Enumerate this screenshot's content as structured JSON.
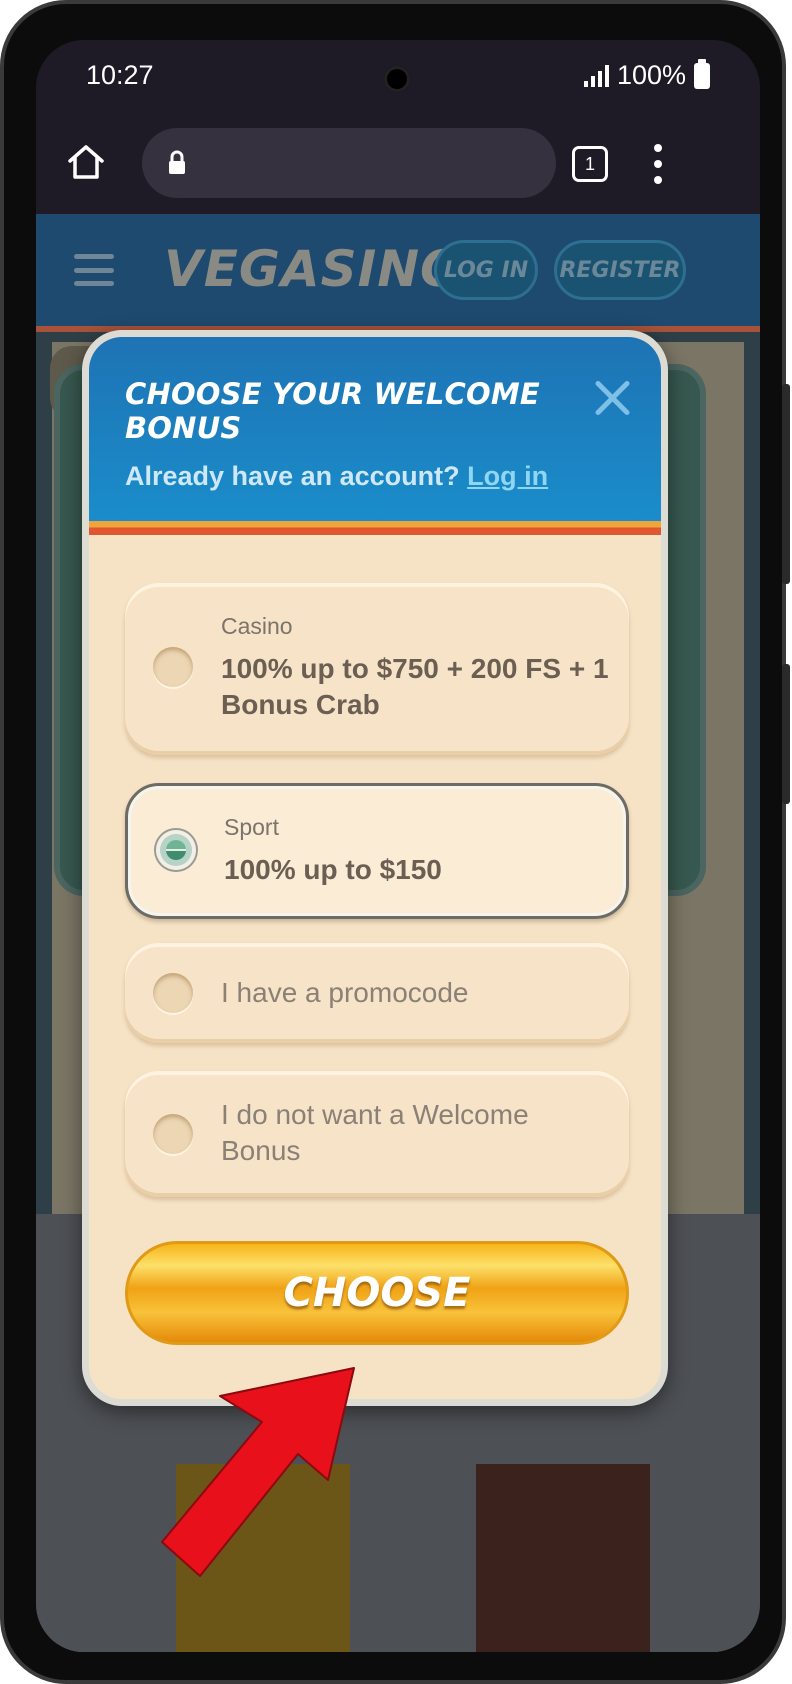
{
  "status_bar": {
    "time": "10:27",
    "battery": "100%"
  },
  "browser": {
    "tab_count": "1"
  },
  "site": {
    "logo": "VEGASINO",
    "login_button": "LOG IN",
    "register_button": "REGISTER"
  },
  "modal": {
    "title": "CHOOSE YOUR WELCOME BONUS",
    "account_prompt": "Already have an account?",
    "login_link": "Log in",
    "options": [
      {
        "category": "Casino",
        "offer": "100% up to $750 + 200 FS + 1 Bonus Crab",
        "selected": false
      },
      {
        "category": "Sport",
        "offer": "100% up to $150",
        "selected": true
      },
      {
        "label": "I have a promocode",
        "selected": false
      },
      {
        "label": "I do not want a Welcome Bonus",
        "selected": false
      }
    ],
    "choose_button": "CHOOSE"
  },
  "colors": {
    "modal_header": "#1a8fcc",
    "modal_body": "#f6e3c6",
    "choose_button": "#f0a215",
    "arrow": "#e8101a"
  },
  "icons": [
    "home-icon",
    "lock-icon",
    "tabs-icon",
    "more-vert-icon",
    "hamburger-icon",
    "close-icon",
    "arrow-icon"
  ]
}
